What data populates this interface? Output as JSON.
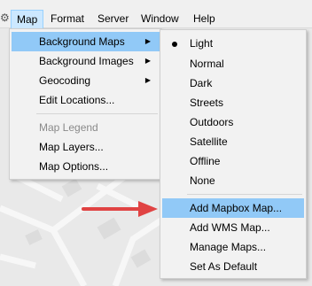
{
  "menubar": {
    "items": [
      "Map",
      "Format",
      "Server",
      "Window",
      "Help"
    ]
  },
  "map_menu": {
    "items": [
      {
        "label": "Background Maps",
        "has_submenu": true
      },
      {
        "label": "Background Images",
        "has_submenu": true
      },
      {
        "label": "Geocoding",
        "has_submenu": true
      },
      {
        "label": "Edit Locations...",
        "has_submenu": false
      },
      {
        "label": "Map Legend",
        "disabled": true
      },
      {
        "label": "Map Layers..."
      },
      {
        "label": "Map Options..."
      }
    ]
  },
  "background_maps_menu": {
    "selected": "Light",
    "styles": [
      "Light",
      "Normal",
      "Dark",
      "Streets",
      "Outdoors",
      "Satellite",
      "Offline",
      "None"
    ],
    "actions": [
      "Add Mapbox Map...",
      "Add WMS Map...",
      "Manage Maps...",
      "Set As Default"
    ]
  },
  "colors": {
    "highlight": "#91c9f7",
    "menu_open": "#cce8ff",
    "arrow": "#e04343"
  },
  "icons": {
    "submenu": "triangle-right",
    "selected": "bullet",
    "pointer": "red-arrow"
  }
}
